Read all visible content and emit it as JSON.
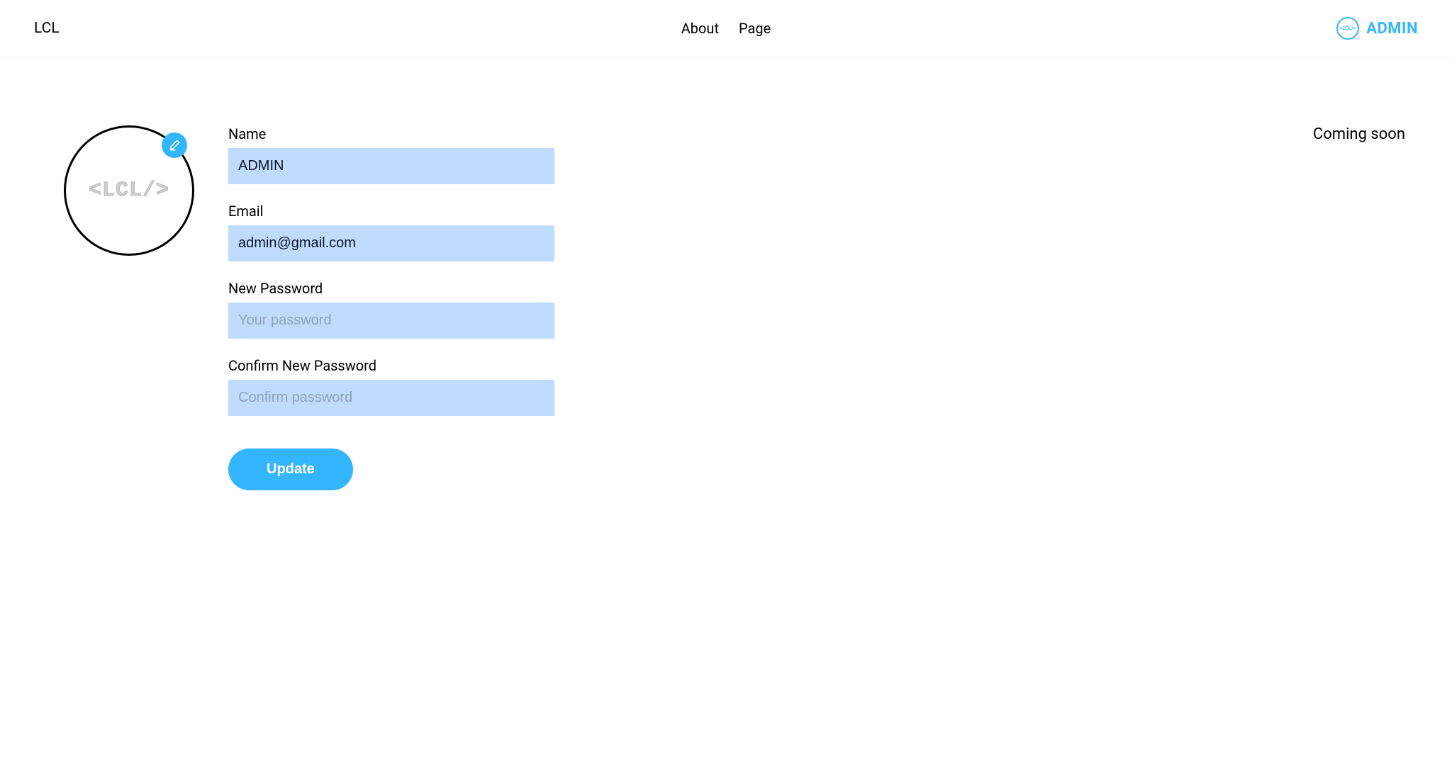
{
  "header": {
    "brand": "LCL",
    "nav": {
      "about": "About",
      "page": "Page"
    },
    "user": {
      "label": "ADMIN",
      "avatar_text": "<LCL/>"
    }
  },
  "avatar": {
    "logo_text": "<LCL/>"
  },
  "form": {
    "name": {
      "label": "Name",
      "value": "ADMIN"
    },
    "email": {
      "label": "Email",
      "value": "admin@gmail.com"
    },
    "new_password": {
      "label": "New Password",
      "placeholder": "Your password"
    },
    "confirm_password": {
      "label": "Confirm New Password",
      "placeholder": "Confirm password"
    },
    "submit_label": "Update"
  },
  "sidebar_right": {
    "text": "Coming soon"
  }
}
